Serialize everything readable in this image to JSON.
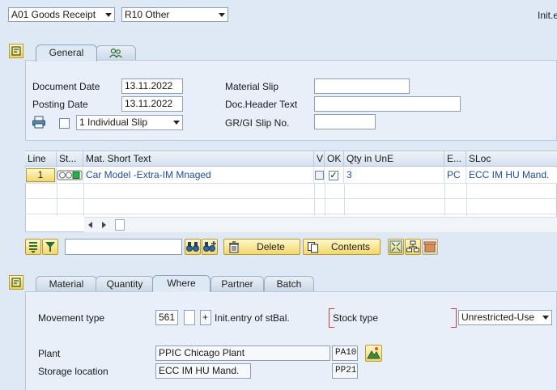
{
  "header": {
    "action_select": "A01 Goods Receipt",
    "refdoc_select": "R10 Other",
    "right_text": "Init.e"
  },
  "top_tabs": [
    {
      "label": "General",
      "active": true
    }
  ],
  "general": {
    "document_date_label": "Document Date",
    "document_date": "13.11.2022",
    "posting_date_label": "Posting Date",
    "posting_date": "13.11.2022",
    "material_slip_label": "Material Slip",
    "material_slip": "",
    "doc_header_label": "Doc.Header Text",
    "doc_header": "",
    "slip_label": "GR/GI Slip No.",
    "slip_no": "",
    "print_version": "1 Individual Slip"
  },
  "grid": {
    "columns": [
      "Line",
      "St...",
      "Mat. Short Text",
      "V",
      "OK",
      "Qty in UnE",
      "E...",
      "SLoc"
    ],
    "rows": [
      {
        "line": "1",
        "mat_text": "Car Model -Extra-IM Mnaged",
        "ok": "✓",
        "qty": "3",
        "unit": "PC",
        "sloc": "ECC IM HU Mand."
      }
    ]
  },
  "grid_toolbar": {
    "delete_label": "Delete",
    "contents_label": "Contents",
    "search_value": ""
  },
  "detail_tabs": [
    {
      "label": "Material"
    },
    {
      "label": "Quantity"
    },
    {
      "label": "Where"
    },
    {
      "label": "Partner"
    },
    {
      "label": "Batch"
    }
  ],
  "where": {
    "movement_type_label": "Movement type",
    "movement_type": "561",
    "plus": "+",
    "movement_text": "Init.entry of stBal.",
    "stock_type_label": "Stock type",
    "stock_type": "Unrestricted-Use",
    "plant_label": "Plant",
    "plant_name": "PPIC Chicago Plant",
    "plant_code": "PA10",
    "sloc_label": "Storage location",
    "sloc_name": "ECC IM HU Mand.",
    "sloc_code": "PP21"
  },
  "colors": {
    "link": "#1f4e9a",
    "button": "#f3d76b",
    "background": "#dfe9f5"
  }
}
